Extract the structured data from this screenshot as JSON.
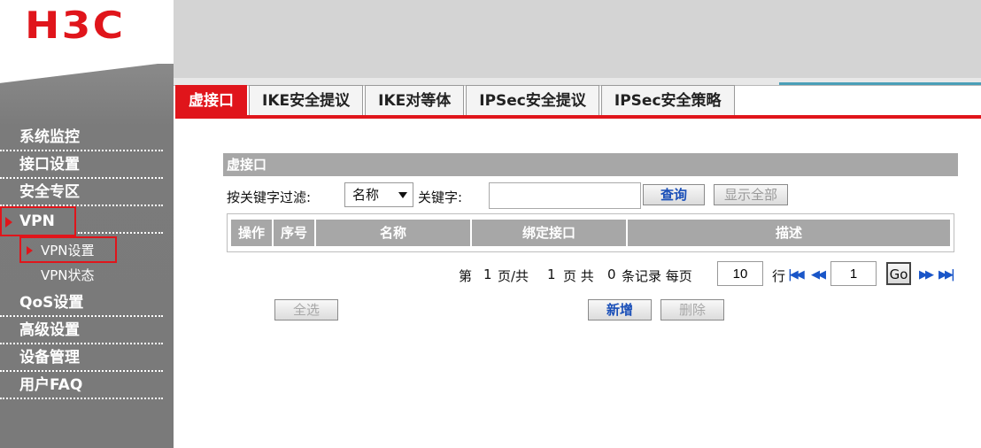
{
  "brand": {
    "logo_text": "H3C",
    "accent_color": "#e0151b"
  },
  "sidebar": {
    "items": [
      {
        "label": "系统监控"
      },
      {
        "label": "接口设置"
      },
      {
        "label": "安全专区"
      },
      {
        "label": "VPN",
        "active": true,
        "children": [
          {
            "label": "VPN设置",
            "active": true
          },
          {
            "label": "VPN状态"
          }
        ]
      },
      {
        "label": "QoS设置"
      },
      {
        "label": "高级设置"
      },
      {
        "label": "设备管理"
      },
      {
        "label": "用户FAQ"
      }
    ]
  },
  "tabs": [
    {
      "label": "虚接口",
      "active": true
    },
    {
      "label": "IKE安全提议"
    },
    {
      "label": "IKE对等体"
    },
    {
      "label": "IPSec安全提议"
    },
    {
      "label": "IPSec安全策略"
    }
  ],
  "section": {
    "title": "虚接口"
  },
  "filter": {
    "label": "按关键字过滤:",
    "select_value": "名称",
    "keyword_label": "关键字:",
    "keyword_value": "",
    "query_label": "查询",
    "show_all_label": "显示全部"
  },
  "table": {
    "columns": [
      "操作",
      "序号",
      "名称",
      "绑定接口",
      "描述"
    ]
  },
  "pager": {
    "page_prefix": "第",
    "current_page": "1",
    "page_of": "页/共",
    "total_pages": "1",
    "total_prefix": "页 共",
    "record_count": "0",
    "records_suffix": "条记录 每页",
    "per_page": "10",
    "rows_suffix": "行",
    "goto_page": "1",
    "go_label": "Go"
  },
  "actions": {
    "select_all_label": "全选",
    "add_label": "新增",
    "delete_label": "删除"
  }
}
